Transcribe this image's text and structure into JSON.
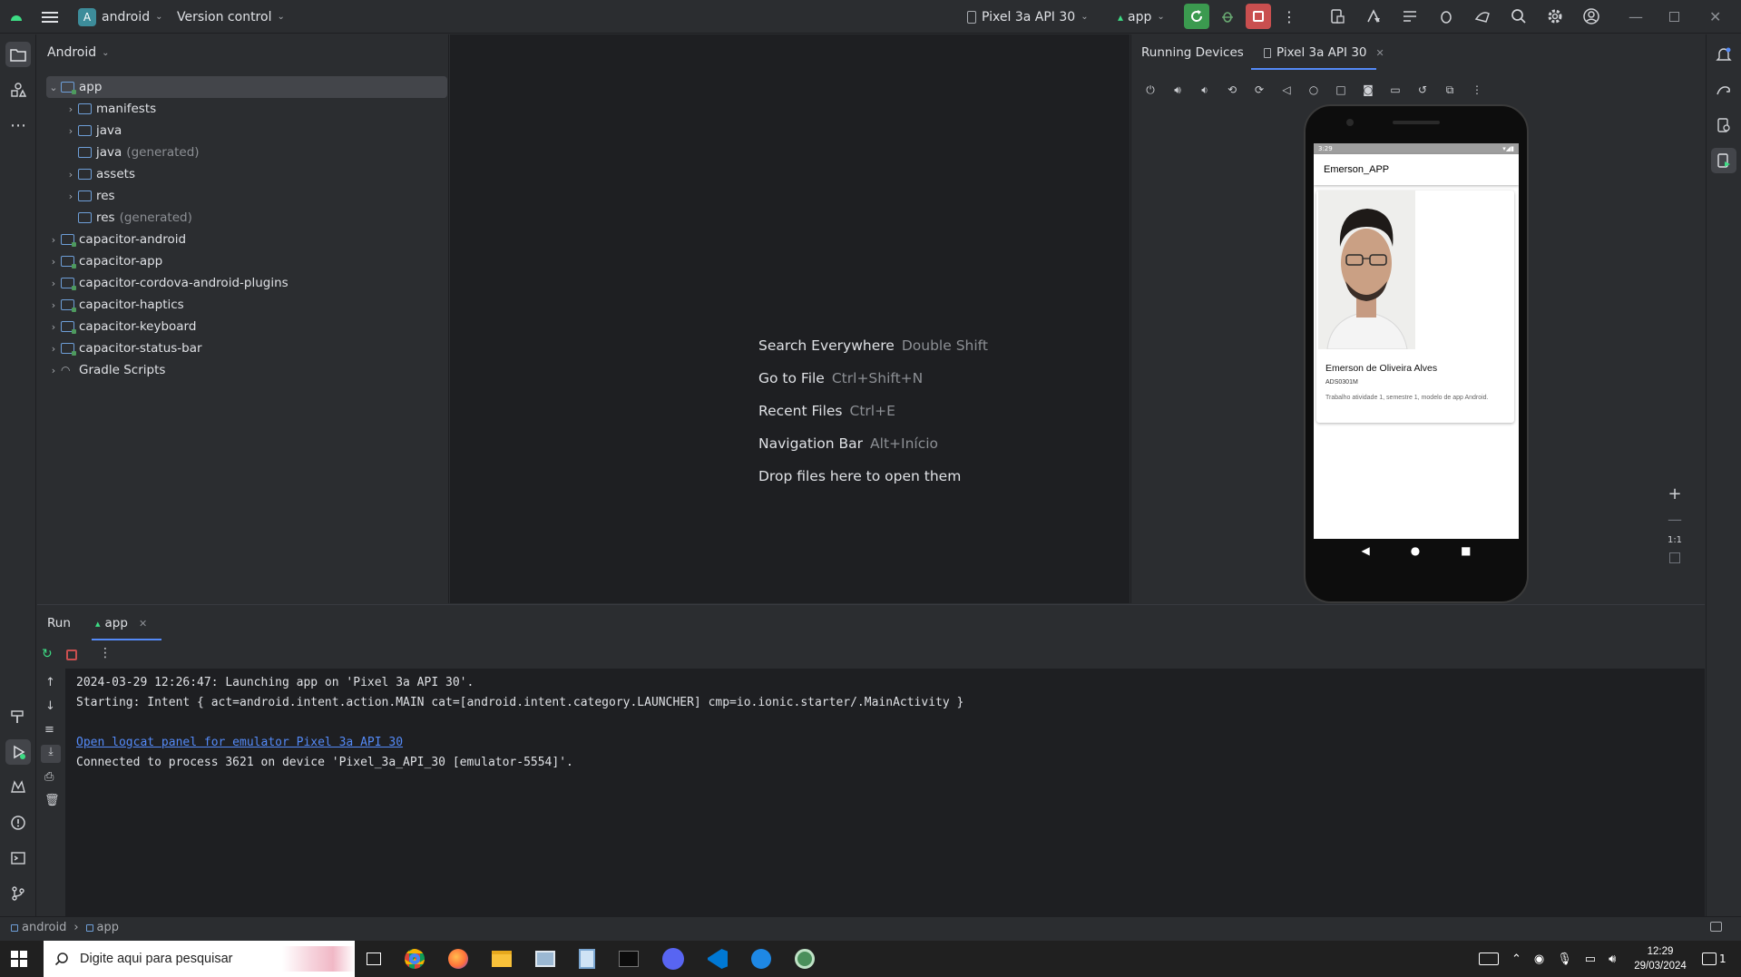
{
  "titlebar": {
    "project_badge": "A",
    "project_name": "android",
    "vcs": "Version control",
    "device": "Pixel 3a API 30",
    "run_config": "app"
  },
  "project_panel": {
    "view_mode": "Android",
    "tree": [
      {
        "label": "app",
        "extra": ""
      },
      {
        "label": "manifests",
        "extra": ""
      },
      {
        "label": "java",
        "extra": ""
      },
      {
        "label": "java",
        "extra": "(generated)"
      },
      {
        "label": "assets",
        "extra": ""
      },
      {
        "label": "res",
        "extra": ""
      },
      {
        "label": "res",
        "extra": "(generated)"
      },
      {
        "label": "capacitor-android",
        "extra": ""
      },
      {
        "label": "capacitor-app",
        "extra": ""
      },
      {
        "label": "capacitor-cordova-android-plugins",
        "extra": ""
      },
      {
        "label": "capacitor-haptics",
        "extra": ""
      },
      {
        "label": "capacitor-keyboard",
        "extra": ""
      },
      {
        "label": "capacitor-status-bar",
        "extra": ""
      },
      {
        "label": "Gradle Scripts",
        "extra": ""
      }
    ]
  },
  "editor_hints": [
    {
      "action": "Search Everywhere",
      "key": "Double Shift"
    },
    {
      "action": "Go to File",
      "key": "Ctrl+Shift+N"
    },
    {
      "action": "Recent Files",
      "key": "Ctrl+E"
    },
    {
      "action": "Navigation Bar",
      "key": "Alt+Início"
    },
    {
      "action": "Drop files here to open them",
      "key": ""
    }
  ],
  "devices_panel": {
    "title": "Running Devices",
    "tab": "Pixel 3a API 30",
    "zoom_label": "1:1"
  },
  "phone": {
    "status_time": "3:29",
    "app_title": "Emerson_APP",
    "person_name": "Emerson de Oliveira Alves",
    "code": "ADS0301M",
    "description": "Trabalho atividade 1, semestre 1, modelo de app Android."
  },
  "run_panel": {
    "tab_run": "Run",
    "tab_app": "app",
    "log": [
      "2024-03-29 12:26:47: Launching app on 'Pixel 3a API 30'.",
      "Starting: Intent { act=android.intent.action.MAIN cat=[android.intent.category.LAUNCHER] cmp=io.ionic.starter/.MainActivity }",
      "",
      "Open logcat panel for emulator Pixel 3a API 30",
      "Connected to process 3621 on device 'Pixel_3a_API_30 [emulator-5554]'."
    ]
  },
  "statusbar": {
    "crumb1": "android",
    "crumb2": "app"
  },
  "taskbar": {
    "search_placeholder": "Digite aqui para pesquisar",
    "time": "12:29",
    "date": "29/03/2024",
    "notif_count": "1"
  },
  "colors": {
    "accent_green": "#3b9a4f",
    "stop_red": "#c94f4f",
    "link_blue": "#548af7"
  }
}
